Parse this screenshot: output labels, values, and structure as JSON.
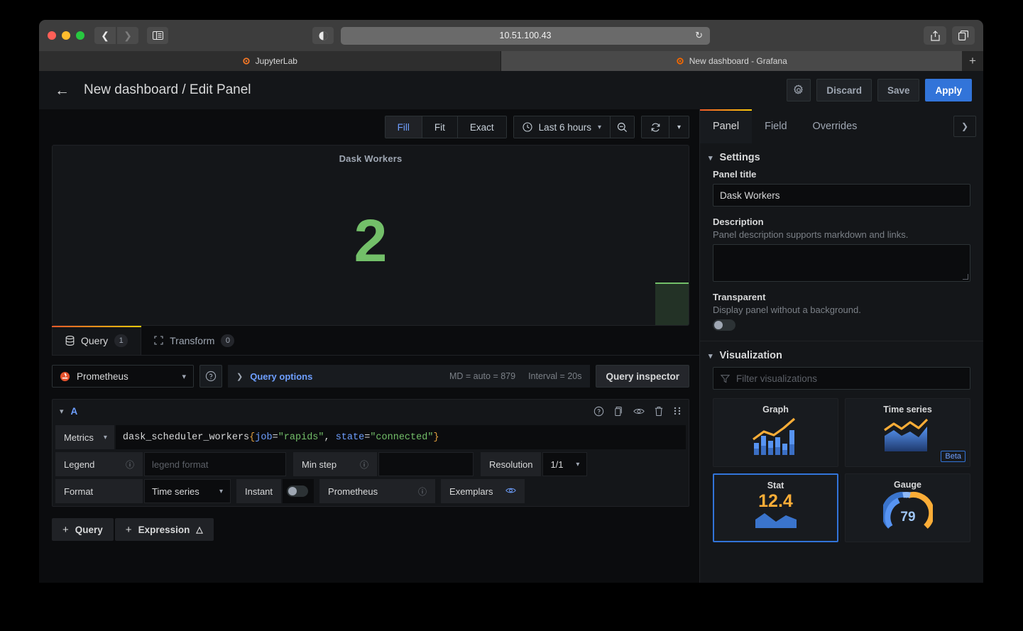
{
  "browser": {
    "address": "10.51.100.43",
    "nav": {
      "back": "back-arrow",
      "forward": "forward-arrow",
      "sidebar": "sidebar-toggle"
    },
    "tabs": [
      {
        "title": "JupyterLab",
        "active": false
      },
      {
        "title": "New dashboard - Grafana",
        "active": true
      }
    ],
    "new_tab_label": "+"
  },
  "header": {
    "title": "New dashboard / Edit Panel",
    "back_label": "←",
    "settings_label": "⚙",
    "discard_label": "Discard",
    "save_label": "Save",
    "apply_label": "Apply"
  },
  "toolbar": {
    "size_modes": [
      {
        "label": "Fill",
        "active": true
      },
      {
        "label": "Fit",
        "active": false
      },
      {
        "label": "Exact",
        "active": false
      }
    ],
    "time_range": "Last 6 hours",
    "zoom_out_label": "zoom-out",
    "refresh_label": "refresh"
  },
  "panel_preview": {
    "title": "Dask Workers",
    "stat_value": "2",
    "stat_color": "#73bf69"
  },
  "query_section": {
    "tabs": [
      {
        "label": "Query",
        "count": "1",
        "active": true,
        "icon": "database-icon"
      },
      {
        "label": "Transform",
        "count": "0",
        "active": false,
        "icon": "transform-icon"
      }
    ],
    "datasource": "Prometheus",
    "query_options_label": "Query options",
    "max_data_points": "MD = auto = 879",
    "interval": "Interval = 20s",
    "query_inspector_label": "Query inspector",
    "query": {
      "ref_id": "A",
      "metrics_label": "Metrics",
      "expression_parts": {
        "metric": "dask_scheduler_workers",
        "open_brace": "{",
        "label1": "job",
        "eq1": "=",
        "value1": "\"rapids\"",
        "comma": ", ",
        "label2": "state",
        "eq2": "=",
        "value2": "\"connected\"",
        "close_brace": "}"
      },
      "legend_label": "Legend",
      "legend_placeholder": "legend format",
      "legend_value": "",
      "min_step_label": "Min step",
      "min_step_value": "",
      "resolution_label": "Resolution",
      "resolution_value": "1/1",
      "format_label": "Format",
      "format_value": "Time series",
      "instant_label": "Instant",
      "instant_on": false,
      "prometheus_label": "Prometheus",
      "exemplars_label": "Exemplars"
    },
    "add_query_label": "Query",
    "add_expression_label": "Expression"
  },
  "options_pane": {
    "tabs": [
      {
        "label": "Panel",
        "active": true
      },
      {
        "label": "Field",
        "active": false
      },
      {
        "label": "Overrides",
        "active": false
      }
    ],
    "settings": {
      "section_title": "Settings",
      "panel_title_label": "Panel title",
      "panel_title_value": "Dask Workers",
      "description_label": "Description",
      "description_help": "Panel description supports markdown and links.",
      "description_value": "",
      "transparent_label": "Transparent",
      "transparent_help": "Display panel without a background.",
      "transparent_on": false
    },
    "visualization": {
      "section_title": "Visualization",
      "filter_placeholder": "Filter visualizations",
      "items": [
        {
          "name": "Graph",
          "selected": false,
          "badge": ""
        },
        {
          "name": "Time series",
          "selected": false,
          "badge": "Beta"
        },
        {
          "name": "Stat",
          "selected": true,
          "badge": "",
          "sample": "12.4"
        },
        {
          "name": "Gauge",
          "selected": false,
          "badge": "",
          "sample": "79"
        }
      ]
    }
  },
  "colors": {
    "accent_blue": "#3274d9",
    "link_blue": "#6e9fff",
    "green": "#73bf69",
    "orange": "#fbad37",
    "tab_gradient_start": "#f05a28",
    "tab_gradient_end": "#fbca0a"
  }
}
